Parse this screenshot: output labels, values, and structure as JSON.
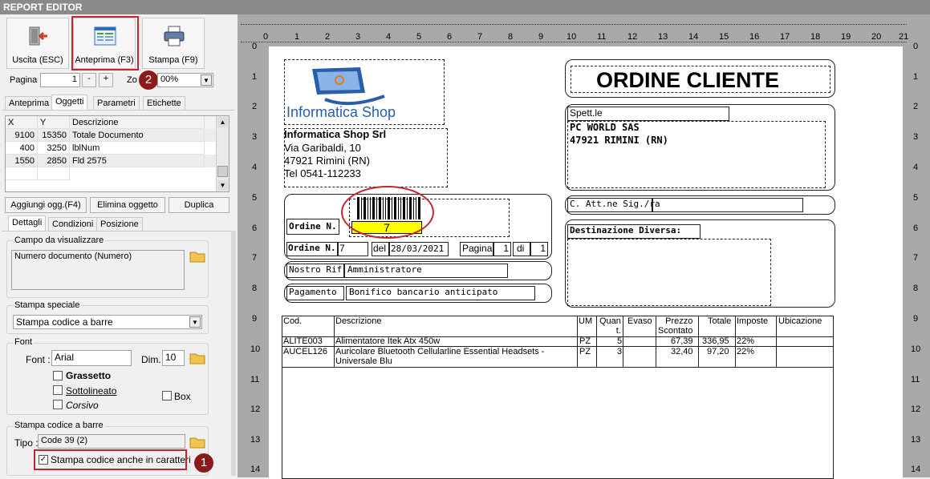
{
  "window": {
    "title": "REPORT EDITOR"
  },
  "toolbar": {
    "exit_label": "Uscita (ESC)",
    "preview_label": "Anteprima (F3)",
    "print_label": "Stampa (F9)"
  },
  "pager": {
    "page_label": "Pagina",
    "page_value": "1",
    "minus": "-",
    "plus": "+",
    "zoom_label": "Zo",
    "zoom_value": "00%"
  },
  "tabs": [
    "Anteprima",
    "Oggetti",
    "Parametri",
    "Etichette"
  ],
  "objects_grid": {
    "headers": [
      "X",
      "Y",
      "Descrizione"
    ],
    "rows": [
      {
        "x": "9100",
        "y": "15350",
        "desc": "Totale Documento"
      },
      {
        "x": "400",
        "y": "3250",
        "desc": "lblNum"
      },
      {
        "x": "1550",
        "y": "2850",
        "desc": "Fld 2575"
      }
    ]
  },
  "object_buttons": {
    "add": "Aggiungi ogg.(F4)",
    "delete": "Elimina oggetto",
    "duplicate": "Duplica"
  },
  "detail_tabs": [
    "Dettagli",
    "Condizioni",
    "Posizione"
  ],
  "field_group": {
    "label": "Campo da visualizzare",
    "value": "Numero documento (Numero)"
  },
  "special_print": {
    "label": "Stampa speciale",
    "value": "Stampa codice a barre"
  },
  "font_group": {
    "label": "Font",
    "font_label": "Font :",
    "font_value": "Arial",
    "size_label": "Dim.",
    "size_value": "10",
    "bold": "Grassetto",
    "underline": "Sottolineato",
    "italic": "Corsivo",
    "box": "Box"
  },
  "barcode_group": {
    "label": "Stampa codice a barre",
    "type_label": "Tipo :",
    "type_value": "Code 39 (2)",
    "print_chars_label": "Stampa codice anche in caratteri"
  },
  "badges": {
    "one": "1",
    "two": "2"
  },
  "ruler": {
    "top": [
      "0",
      "1",
      "2",
      "3",
      "4",
      "5",
      "6",
      "7",
      "8",
      "9",
      "10",
      "11",
      "12",
      "13",
      "14",
      "15",
      "16",
      "17",
      "18",
      "19",
      "20",
      "21"
    ],
    "left": [
      "0",
      "1",
      "2",
      "3",
      "4",
      "5",
      "6",
      "7",
      "8",
      "9",
      "10",
      "11",
      "12",
      "13",
      "14"
    ]
  },
  "report": {
    "logo_text": "Informatica Shop",
    "company": "Informatica Shop Srl",
    "address1": "Via Garibaldi, 10",
    "address2": "47921 Rimini (RN)",
    "phone": "Tel 0541-112233",
    "title": "ORDINE CLIENTE",
    "spett_label": "Spett.le",
    "customer_name": "PC WORLD SAS",
    "customer_city": "47921 RIMINI (RN)",
    "attn_label": "C. Att.ne Sig./ra",
    "dest_label": "Destinazione Diversa:",
    "order_label": "Ordine N.",
    "barcode_value": "7",
    "order_label2": "Ordine N.",
    "order_number": "7",
    "date_label": "del",
    "date_value": "28/03/2021",
    "page_label": "Pagina",
    "page_value": "1",
    "of_label": "di",
    "of_value": "1",
    "ref_label": "Nostro Rif. :",
    "ref_value": "Amministratore",
    "payment_label": "Pagamento",
    "payment_value": "Bonifico bancario anticipato",
    "table": {
      "headers": {
        "cod": "Cod.",
        "desc": "Descrizione",
        "um": "UM",
        "qty": "Quan\nt.",
        "evaso": "Evaso",
        "price": "Prezzo\nScontato",
        "total": "Totale",
        "tax": "Imposte",
        "loc": "Ubicazione"
      },
      "rows": [
        {
          "cod": "ALITE003",
          "desc": "Alimentatore Itek Atx 450w",
          "um": "PZ",
          "qty": "5",
          "price": "67,39",
          "total": "336,95",
          "tax": "22%"
        },
        {
          "cod": "AUCEL126",
          "desc": "Auricolare Bluetooth Cellularline Essential Headsets - Universale Blu",
          "um": "PZ",
          "qty": "3",
          "price": "32,40",
          "total": "97,20",
          "tax": "22%"
        }
      ]
    }
  },
  "colors": {
    "accent_red": "#c0282d",
    "badge": "#8b1a1a",
    "barcode_highlight": "#ffff00",
    "logo_blue": "#2a5ea8"
  }
}
